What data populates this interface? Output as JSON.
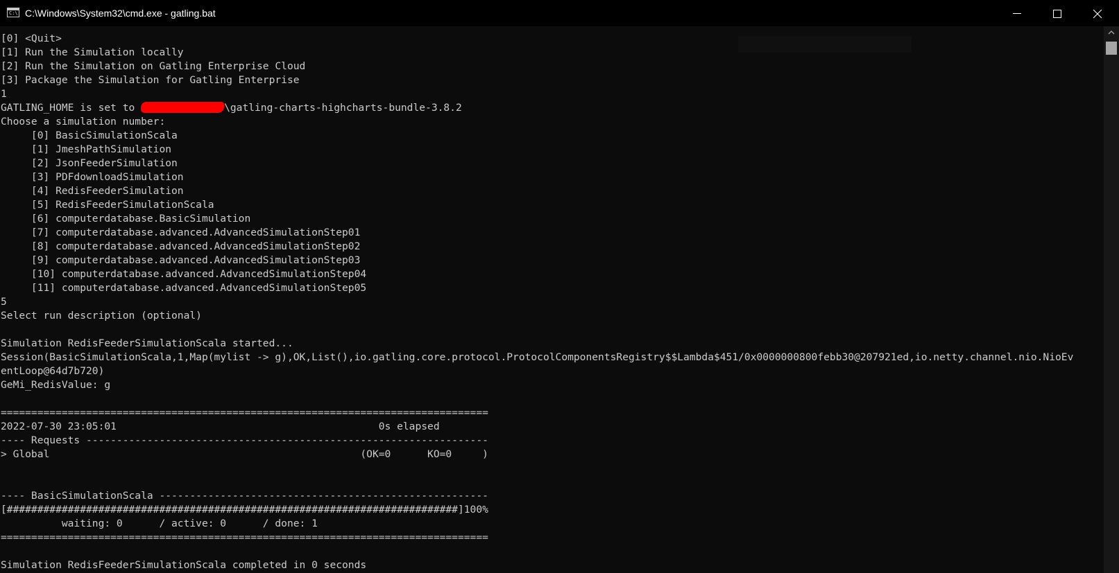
{
  "window": {
    "title": "C:\\Windows\\System32\\cmd.exe - gatling.bat",
    "icon": "cmd-icon",
    "controls": [
      "minimize-icon",
      "maximize-icon",
      "close-icon"
    ]
  },
  "colors": {
    "background": "#0c0c0c",
    "text": "#cccccc",
    "titlebar": "#000000",
    "redaction": "#ff0000"
  },
  "console": {
    "menu": [
      "[0] <Quit>",
      "[1] Run the Simulation locally",
      "[2] Run the Simulation on Gatling Enterprise Cloud",
      "[3] Package the Simulation for Gatling Enterprise"
    ],
    "menu_choice": "1",
    "gatling_home_prefix": "GATLING_HOME is set to ",
    "gatling_home_suffix": "\\gatling-charts-highcharts-bundle-3.8.2",
    "choose_prompt": "Choose a simulation number:",
    "simulations": [
      "     [0] BasicSimulationScala",
      "     [1] JmeshPathSimulation",
      "     [2] JsonFeederSimulation",
      "     [3] PDFdownloadSimulation",
      "     [4] RedisFeederSimulation",
      "     [5] RedisFeederSimulationScala",
      "     [6] computerdatabase.BasicSimulation",
      "     [7] computerdatabase.advanced.AdvancedSimulationStep01",
      "     [8] computerdatabase.advanced.AdvancedSimulationStep02",
      "     [9] computerdatabase.advanced.AdvancedSimulationStep03",
      "     [10] computerdatabase.advanced.AdvancedSimulationStep04",
      "     [11] computerdatabase.advanced.AdvancedSimulationStep05"
    ],
    "simulation_choice": "5",
    "description_prompt": "Select run description (optional)",
    "started": "Simulation RedisFeederSimulationScala started...",
    "session_line1": "Session(BasicSimulationScala,1,Map(mylist -> g),OK,List(),io.gatling.core.protocol.ProtocolComponentsRegistry$$Lambda$451/0x0000000800febb30@207921ed,io.netty.channel.nio.NioEv",
    "session_line2": "entLoop@64d7b720)",
    "redis_value": "GeMi_RedisValue: g",
    "separator": "================================================================================",
    "timestamp_line": "2022-07-30 23:05:01                                           0s elapsed",
    "requests_header": "---- Requests ------------------------------------------------------------------",
    "global_line": "> Global                                                   (OK=0      KO=0     )",
    "scenario_header": "---- BasicSimulationScala ------------------------------------------------------",
    "progress_bar": "[##########################################################################]100%",
    "counts_line": "          waiting: 0      / active: 0      / done: 1",
    "completed": "Simulation RedisFeederSimulationScala completed in 0 seconds"
  }
}
